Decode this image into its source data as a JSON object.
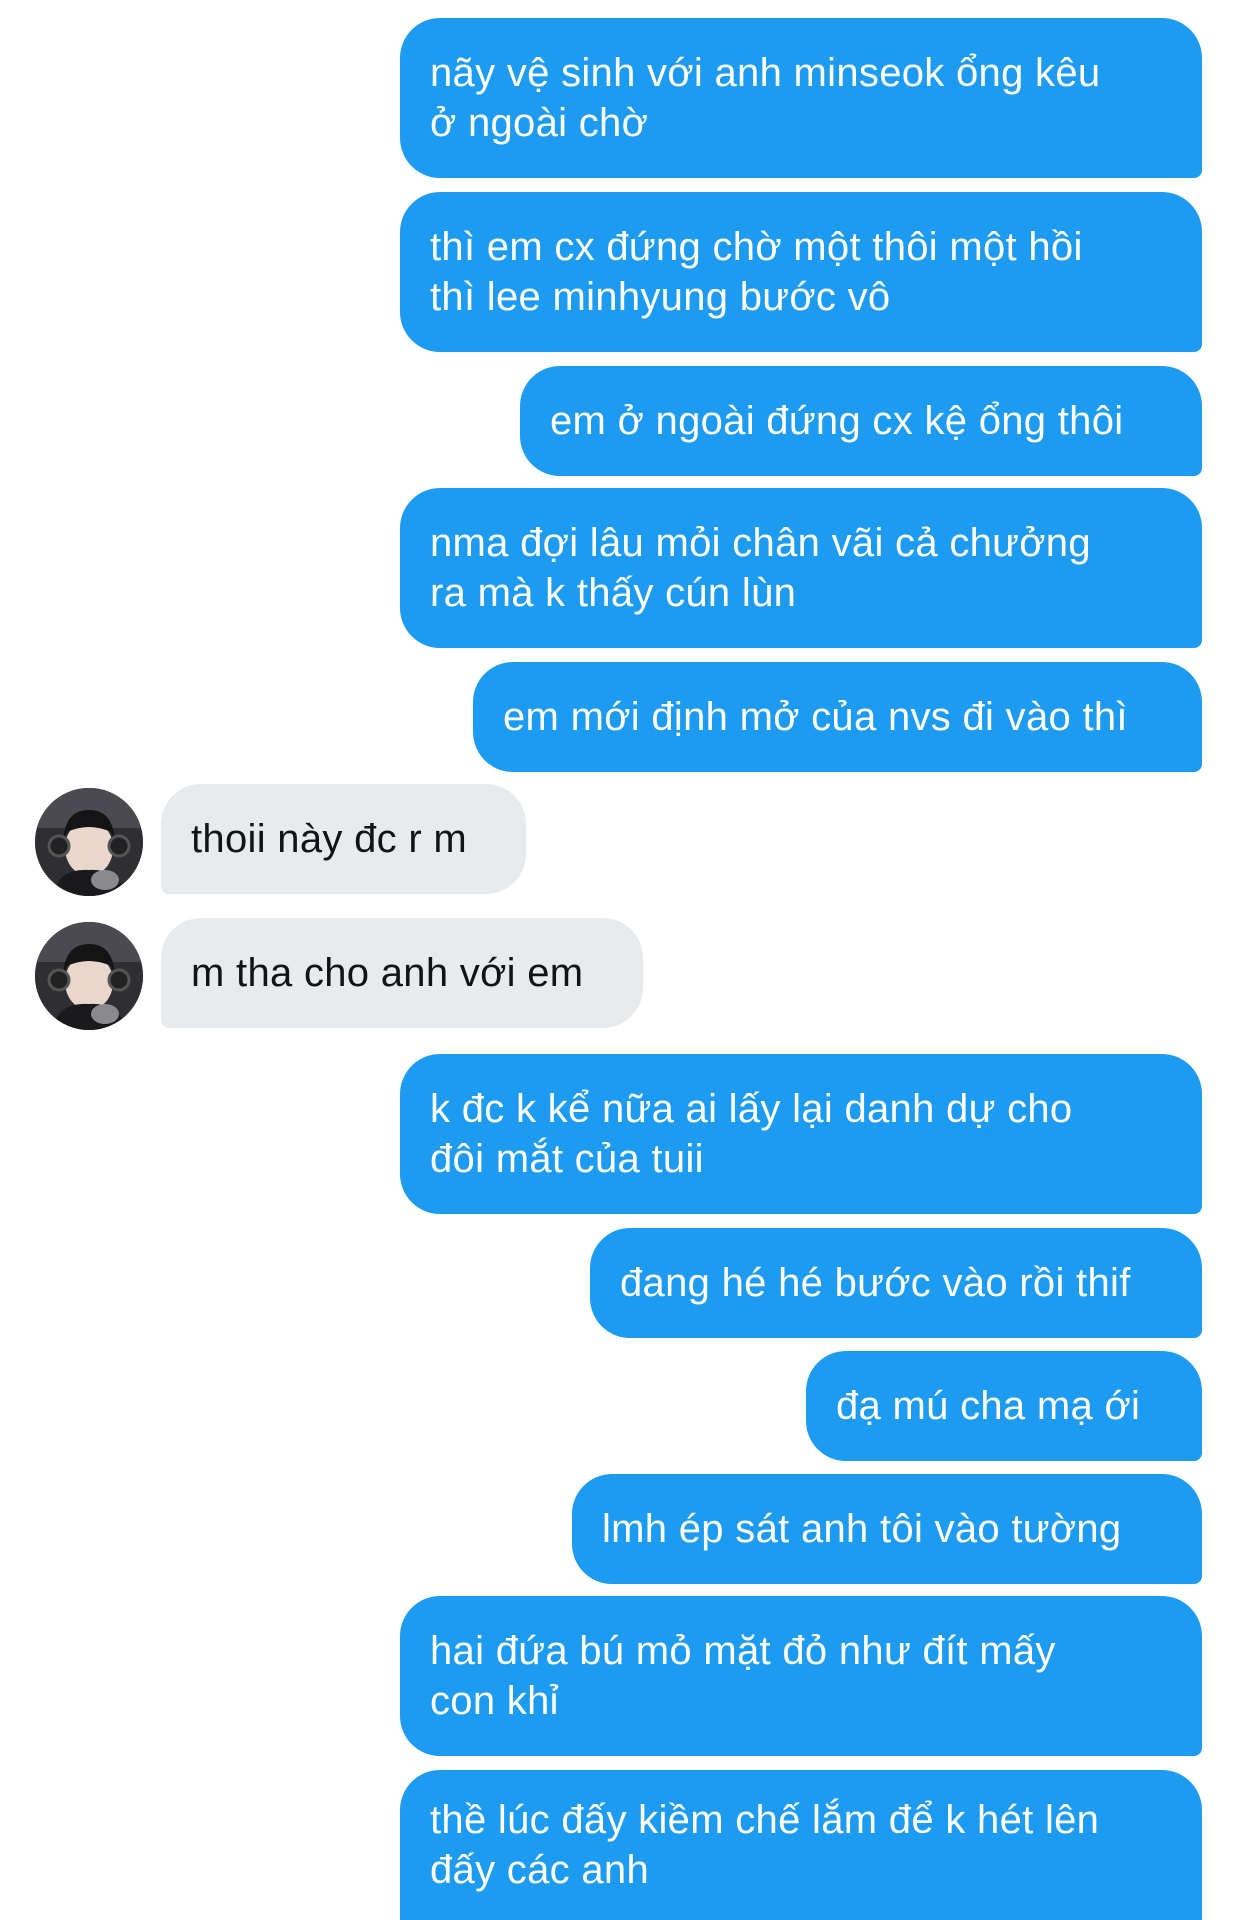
{
  "colors": {
    "outgoing_bubble": "#1d9bf0",
    "incoming_bubble": "#e8ebee",
    "outgoing_text": "#ffffff",
    "incoming_text": "#0f1419"
  },
  "messages": [
    {
      "direction": "out",
      "text": "nãy vệ sinh với anh minseok ổng kêu\nở ngoài chờ"
    },
    {
      "direction": "out",
      "text": "thì em cx đứng chờ một thôi một hồi\nthì lee minhyung bước vô"
    },
    {
      "direction": "out",
      "text": "em ở ngoài đứng cx kệ ổng thôi"
    },
    {
      "direction": "out",
      "text": "nma đợi lâu mỏi chân vãi cả chưởng\nra mà k thấy cún lùn"
    },
    {
      "direction": "out",
      "text": "em mới định mở của nvs đi vào thì"
    },
    {
      "direction": "in",
      "text": "thoii này đc r m",
      "avatar_icon": "user-avatar"
    },
    {
      "direction": "in",
      "text": "m tha cho anh với em",
      "avatar_icon": "user-avatar"
    },
    {
      "direction": "out",
      "text": "k đc k kể nữa ai lấy lại danh dự cho\nđôi mắt của tuii"
    },
    {
      "direction": "out",
      "text": "đang hé hé bước vào rồi thif"
    },
    {
      "direction": "out",
      "text": "đạ mú cha mạ ới"
    },
    {
      "direction": "out",
      "text": "lmh ép sát anh tôi vào tường"
    },
    {
      "direction": "out",
      "text": "hai đứa bú mỏ mặt đỏ như đít mấy\ncon khỉ"
    },
    {
      "direction": "out",
      "text": "thề lúc đấy kiềm chế lắm để k hét lên\nđấy các anh"
    }
  ]
}
